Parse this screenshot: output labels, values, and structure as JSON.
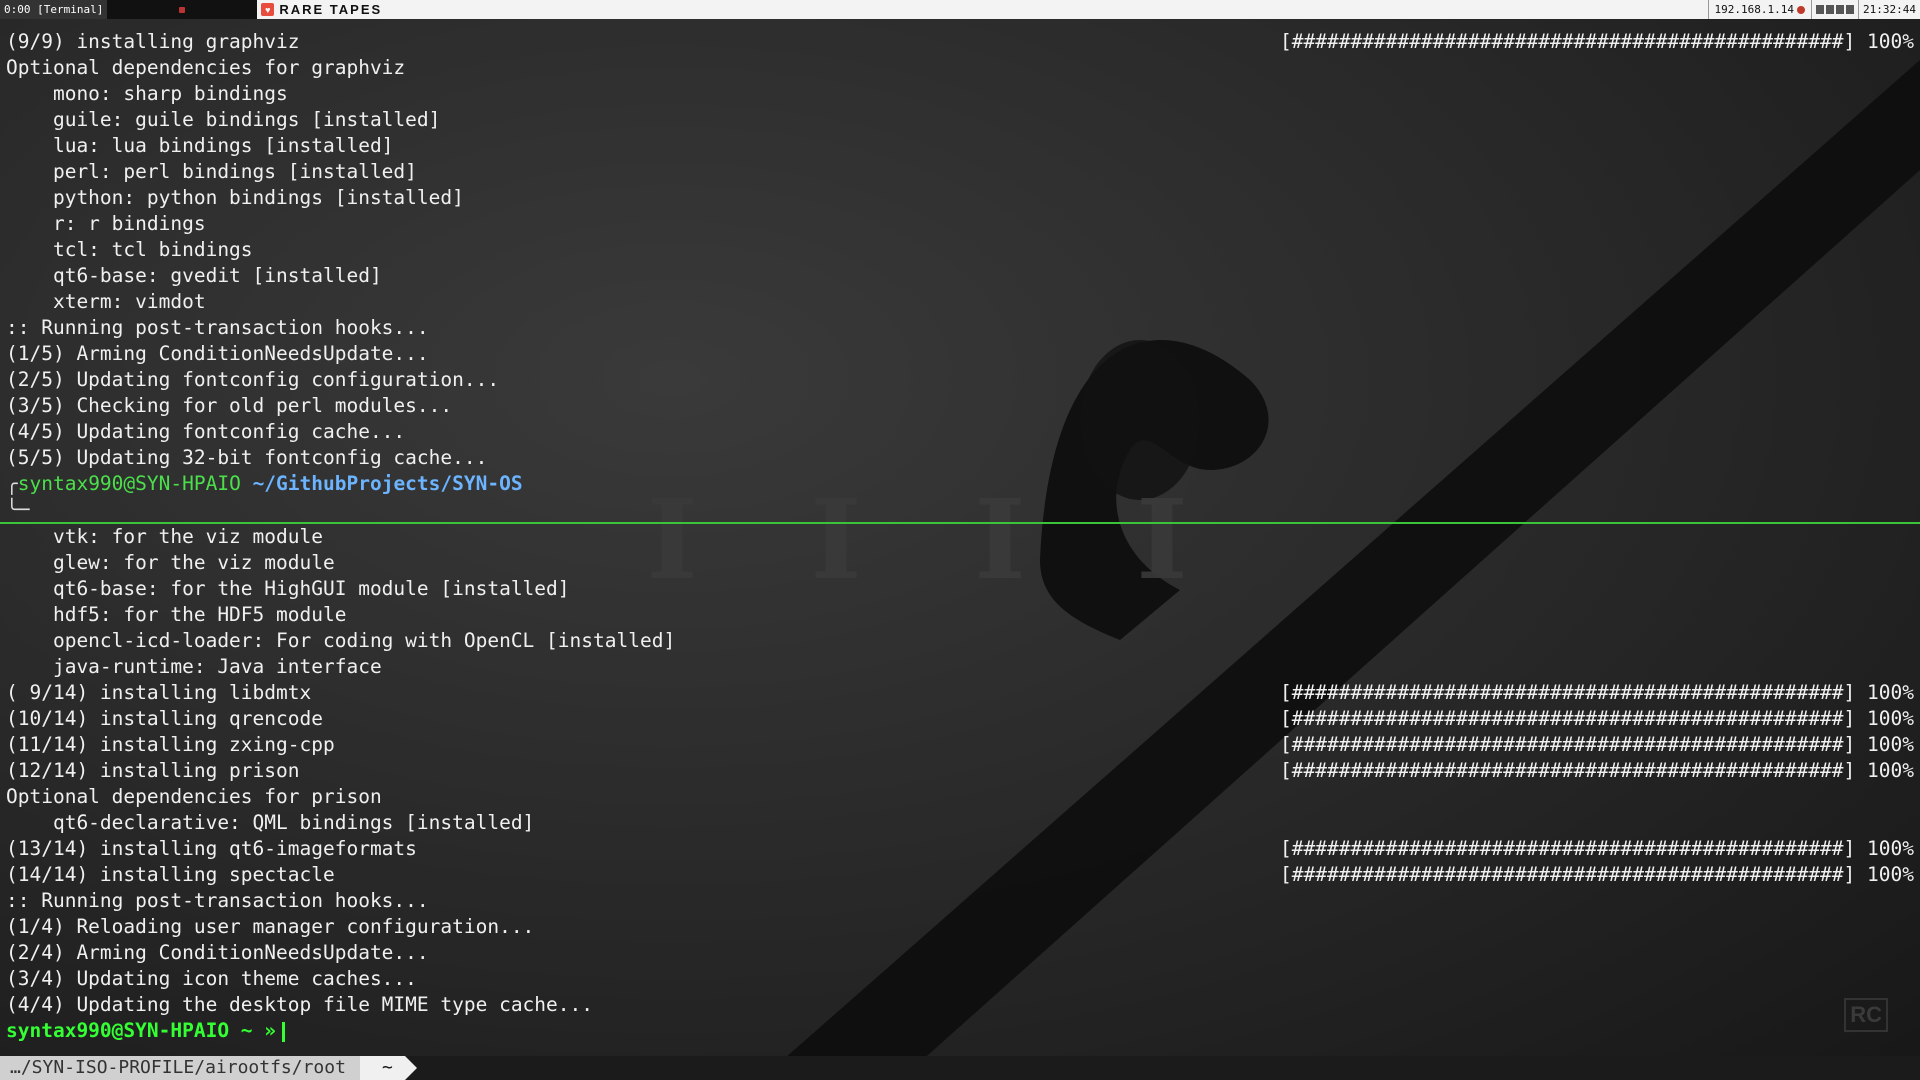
{
  "topbar": {
    "workspace": "0:00 [Terminal]",
    "window_title": "RARE TAPES",
    "ip": "192.168.1.14",
    "clock": "21:32:44",
    "icons": [
      "app-icon",
      "status-dot-icon",
      "tray-icons"
    ]
  },
  "colors": {
    "prompt_user": "#33ff33",
    "prompt_path": "#6cb4ff",
    "divider": "#3bc43b",
    "text": "#f0f0f0"
  },
  "progress": {
    "bar": "[###############################################]",
    "pct": "100%"
  },
  "pane_top": {
    "lines": [
      {
        "text": "(9/9) installing graphviz",
        "bar": true
      },
      {
        "text": "Optional dependencies for graphviz"
      },
      {
        "text": "    mono: sharp bindings"
      },
      {
        "text": "    guile: guile bindings [installed]"
      },
      {
        "text": "    lua: lua bindings [installed]"
      },
      {
        "text": "    perl: perl bindings [installed]"
      },
      {
        "text": "    python: python bindings [installed]"
      },
      {
        "text": "    r: r bindings"
      },
      {
        "text": "    tcl: tcl bindings"
      },
      {
        "text": "    qt6-base: gvedit [installed]"
      },
      {
        "text": "    xterm: vimdot"
      },
      {
        "text": ":: Running post-transaction hooks..."
      },
      {
        "text": "(1/5) Arming ConditionNeedsUpdate..."
      },
      {
        "text": "(2/5) Updating fontconfig configuration..."
      },
      {
        "text": "(3/5) Checking for old perl modules..."
      },
      {
        "text": "(4/5) Updating fontconfig cache..."
      },
      {
        "text": "(5/5) Updating 32-bit fontconfig cache..."
      }
    ],
    "prompt_user": "syntax990@SYN-HPAIO",
    "prompt_path": "~/GithubProjects/SYN-OS"
  },
  "pane_bottom": {
    "lines": [
      {
        "text": "    vtk: for the viz module"
      },
      {
        "text": "    glew: for the viz module"
      },
      {
        "text": "    qt6-base: for the HighGUI module [installed]"
      },
      {
        "text": "    hdf5: for the HDF5 module"
      },
      {
        "text": "    opencl-icd-loader: For coding with OpenCL [installed]"
      },
      {
        "text": "    java-runtime: Java interface"
      },
      {
        "text": "( 9/14) installing libdmtx",
        "bar": true
      },
      {
        "text": "(10/14) installing qrencode",
        "bar": true
      },
      {
        "text": "(11/14) installing zxing-cpp",
        "bar": true
      },
      {
        "text": "(12/14) installing prison",
        "bar": true
      },
      {
        "text": "Optional dependencies for prison"
      },
      {
        "text": "    qt6-declarative: QML bindings [installed]"
      },
      {
        "text": "(13/14) installing qt6-imageformats",
        "bar": true
      },
      {
        "text": "(14/14) installing spectacle",
        "bar": true
      },
      {
        "text": ":: Running post-transaction hooks..."
      },
      {
        "text": "(1/4) Reloading user manager configuration..."
      },
      {
        "text": "(2/4) Arming ConditionNeedsUpdate..."
      },
      {
        "text": "(3/4) Updating icon theme caches..."
      },
      {
        "text": "(4/4) Updating the desktop file MIME type cache..."
      }
    ],
    "prompt": "syntax990@SYN-HPAIO ~ »"
  },
  "statusbar": {
    "path": "…/SYN-ISO-PROFILE/airootfs/root",
    "home": "~"
  },
  "wallpaper": {
    "overlay_letters": [
      "I",
      "I",
      "I",
      "I"
    ],
    "watermark": "RC"
  }
}
